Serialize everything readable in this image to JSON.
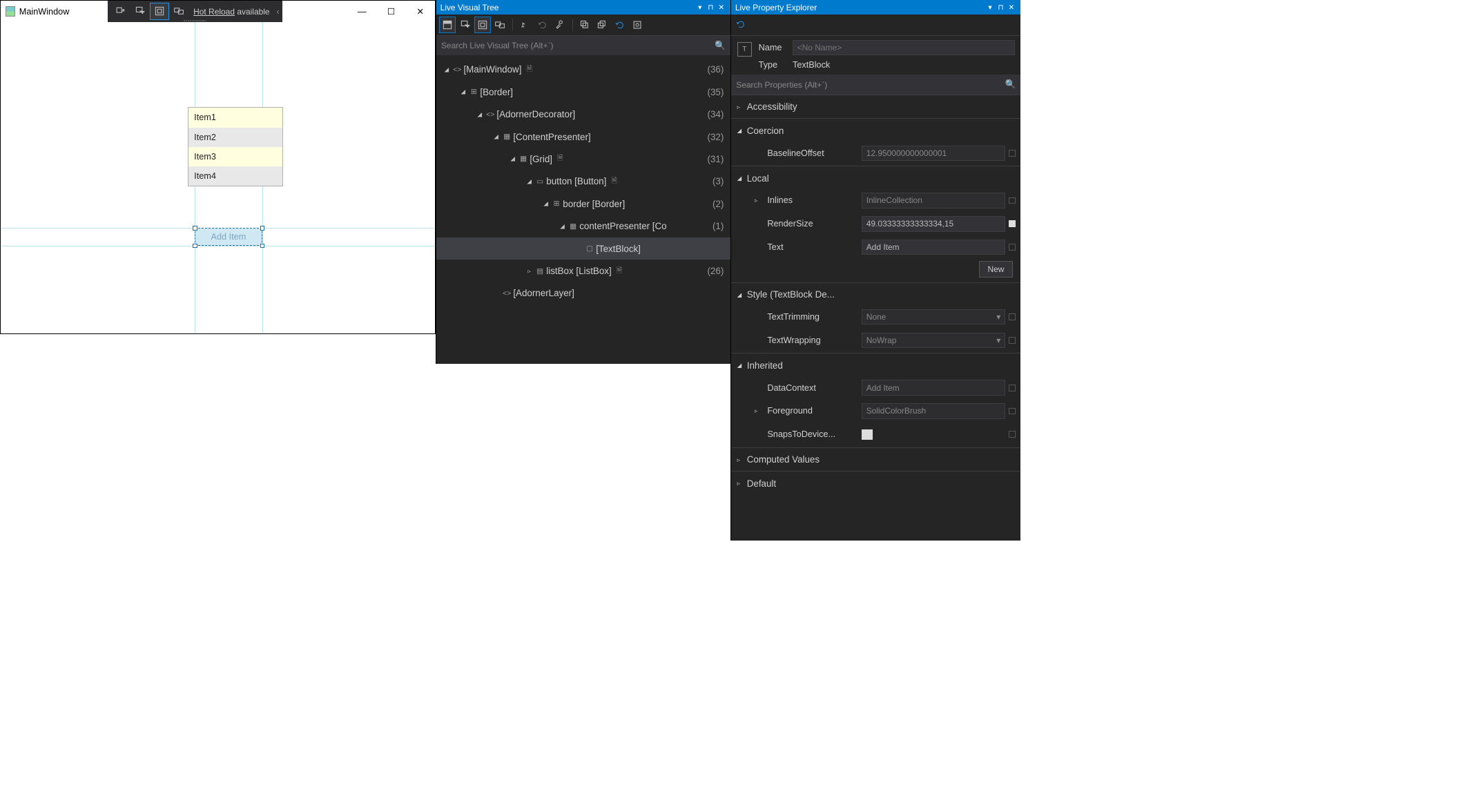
{
  "appWindow": {
    "title": "MainWindow",
    "hotReloadUnderlined": "Hot Reload",
    "hotReloadRest": " available",
    "listItems": [
      "Item1",
      "Item2",
      "Item3",
      "Item4"
    ],
    "addButton": "Add Item"
  },
  "lvt": {
    "title": "Live Visual Tree",
    "searchPlaceholder": "Search Live Visual Tree (Alt+`)",
    "nodes": [
      {
        "indent": 0,
        "exp": "▲",
        "icon": "<>",
        "label": "[MainWindow]",
        "doc": true,
        "count": "(36)"
      },
      {
        "indent": 1,
        "exp": "▲",
        "icon": "⊞",
        "label": "[Border]",
        "count": "(35)"
      },
      {
        "indent": 2,
        "exp": "▲",
        "icon": "<>",
        "label": "[AdornerDecorator]",
        "count": "(34)"
      },
      {
        "indent": 3,
        "exp": "▲",
        "icon": "▦",
        "label": "[ContentPresenter]",
        "count": "(32)"
      },
      {
        "indent": 4,
        "exp": "▲",
        "icon": "▦",
        "label": "[Grid]",
        "doc": true,
        "count": "(31)"
      },
      {
        "indent": 5,
        "exp": "▲",
        "icon": "▭",
        "label": "button [Button]",
        "doc": true,
        "count": "(3)"
      },
      {
        "indent": 6,
        "exp": "▲",
        "icon": "⊞",
        "label": "border [Border]",
        "count": "(2)"
      },
      {
        "indent": 7,
        "exp": "▲",
        "icon": "▦",
        "label": "contentPresenter [Co",
        "count": "(1)"
      },
      {
        "indent": 8,
        "exp": "",
        "icon": "▢",
        "label": "[TextBlock]",
        "selected": true
      },
      {
        "indent": 5,
        "exp": "▹",
        "icon": "▤",
        "label": "listBox [ListBox]",
        "doc": true,
        "count": "(26)"
      },
      {
        "indent": 3,
        "exp": "",
        "icon": "<>",
        "label": "[AdornerLayer]"
      }
    ]
  },
  "lpe": {
    "title": "Live Property Explorer",
    "headerNameLabel": "Name",
    "headerNamePlaceholder": "<No Name>",
    "headerTypeLabel": "Type",
    "headerTypeValue": "TextBlock",
    "searchPlaceholder": "Search Properties (Alt+`)",
    "sections": {
      "accessibility": "Accessibility",
      "coercion": "Coercion",
      "baselineOffset": {
        "label": "BaselineOffset",
        "value": "12.950000000000001"
      },
      "local": "Local",
      "inlines": {
        "label": "Inlines",
        "value": "InlineCollection"
      },
      "renderSize": {
        "label": "RenderSize",
        "value": "49.03333333333334,15"
      },
      "text": {
        "label": "Text",
        "value": "Add Item"
      },
      "newBtn": "New",
      "style": "Style (TextBlock De...",
      "textTrimming": {
        "label": "TextTrimming",
        "value": "None"
      },
      "textWrapping": {
        "label": "TextWrapping",
        "value": "NoWrap"
      },
      "inherited": "Inherited",
      "dataContext": {
        "label": "DataContext",
        "value": "Add Item"
      },
      "foreground": {
        "label": "Foreground",
        "value": "SolidColorBrush"
      },
      "snaps": {
        "label": "SnapsToDevice...",
        "value": ""
      },
      "computed": "Computed Values",
      "default": "Default"
    }
  }
}
